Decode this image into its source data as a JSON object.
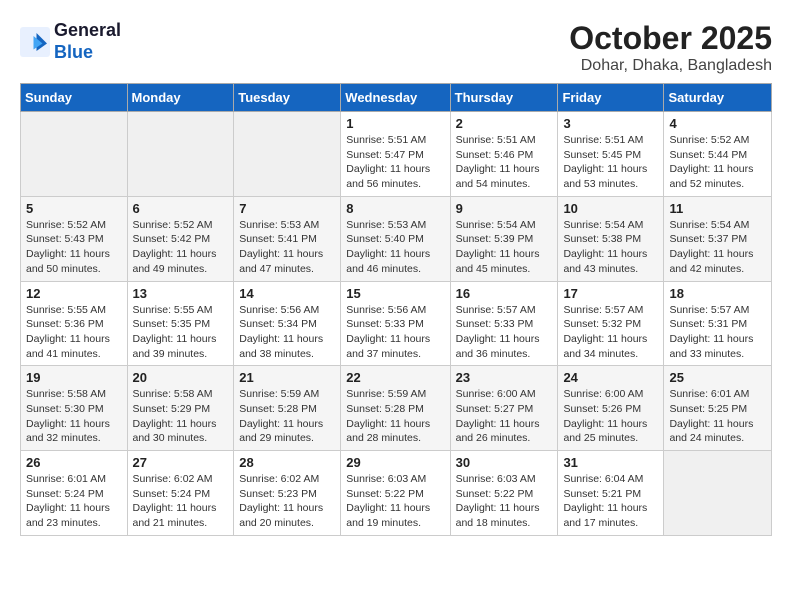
{
  "header": {
    "logo_line1": "General",
    "logo_line2": "Blue",
    "title": "October 2025",
    "subtitle": "Dohar, Dhaka, Bangladesh"
  },
  "weekdays": [
    "Sunday",
    "Monday",
    "Tuesday",
    "Wednesday",
    "Thursday",
    "Friday",
    "Saturday"
  ],
  "weeks": [
    [
      {
        "day": "",
        "info": ""
      },
      {
        "day": "",
        "info": ""
      },
      {
        "day": "",
        "info": ""
      },
      {
        "day": "1",
        "info": "Sunrise: 5:51 AM\nSunset: 5:47 PM\nDaylight: 11 hours and 56 minutes."
      },
      {
        "day": "2",
        "info": "Sunrise: 5:51 AM\nSunset: 5:46 PM\nDaylight: 11 hours and 54 minutes."
      },
      {
        "day": "3",
        "info": "Sunrise: 5:51 AM\nSunset: 5:45 PM\nDaylight: 11 hours and 53 minutes."
      },
      {
        "day": "4",
        "info": "Sunrise: 5:52 AM\nSunset: 5:44 PM\nDaylight: 11 hours and 52 minutes."
      }
    ],
    [
      {
        "day": "5",
        "info": "Sunrise: 5:52 AM\nSunset: 5:43 PM\nDaylight: 11 hours and 50 minutes."
      },
      {
        "day": "6",
        "info": "Sunrise: 5:52 AM\nSunset: 5:42 PM\nDaylight: 11 hours and 49 minutes."
      },
      {
        "day": "7",
        "info": "Sunrise: 5:53 AM\nSunset: 5:41 PM\nDaylight: 11 hours and 47 minutes."
      },
      {
        "day": "8",
        "info": "Sunrise: 5:53 AM\nSunset: 5:40 PM\nDaylight: 11 hours and 46 minutes."
      },
      {
        "day": "9",
        "info": "Sunrise: 5:54 AM\nSunset: 5:39 PM\nDaylight: 11 hours and 45 minutes."
      },
      {
        "day": "10",
        "info": "Sunrise: 5:54 AM\nSunset: 5:38 PM\nDaylight: 11 hours and 43 minutes."
      },
      {
        "day": "11",
        "info": "Sunrise: 5:54 AM\nSunset: 5:37 PM\nDaylight: 11 hours and 42 minutes."
      }
    ],
    [
      {
        "day": "12",
        "info": "Sunrise: 5:55 AM\nSunset: 5:36 PM\nDaylight: 11 hours and 41 minutes."
      },
      {
        "day": "13",
        "info": "Sunrise: 5:55 AM\nSunset: 5:35 PM\nDaylight: 11 hours and 39 minutes."
      },
      {
        "day": "14",
        "info": "Sunrise: 5:56 AM\nSunset: 5:34 PM\nDaylight: 11 hours and 38 minutes."
      },
      {
        "day": "15",
        "info": "Sunrise: 5:56 AM\nSunset: 5:33 PM\nDaylight: 11 hours and 37 minutes."
      },
      {
        "day": "16",
        "info": "Sunrise: 5:57 AM\nSunset: 5:33 PM\nDaylight: 11 hours and 36 minutes."
      },
      {
        "day": "17",
        "info": "Sunrise: 5:57 AM\nSunset: 5:32 PM\nDaylight: 11 hours and 34 minutes."
      },
      {
        "day": "18",
        "info": "Sunrise: 5:57 AM\nSunset: 5:31 PM\nDaylight: 11 hours and 33 minutes."
      }
    ],
    [
      {
        "day": "19",
        "info": "Sunrise: 5:58 AM\nSunset: 5:30 PM\nDaylight: 11 hours and 32 minutes."
      },
      {
        "day": "20",
        "info": "Sunrise: 5:58 AM\nSunset: 5:29 PM\nDaylight: 11 hours and 30 minutes."
      },
      {
        "day": "21",
        "info": "Sunrise: 5:59 AM\nSunset: 5:28 PM\nDaylight: 11 hours and 29 minutes."
      },
      {
        "day": "22",
        "info": "Sunrise: 5:59 AM\nSunset: 5:28 PM\nDaylight: 11 hours and 28 minutes."
      },
      {
        "day": "23",
        "info": "Sunrise: 6:00 AM\nSunset: 5:27 PM\nDaylight: 11 hours and 26 minutes."
      },
      {
        "day": "24",
        "info": "Sunrise: 6:00 AM\nSunset: 5:26 PM\nDaylight: 11 hours and 25 minutes."
      },
      {
        "day": "25",
        "info": "Sunrise: 6:01 AM\nSunset: 5:25 PM\nDaylight: 11 hours and 24 minutes."
      }
    ],
    [
      {
        "day": "26",
        "info": "Sunrise: 6:01 AM\nSunset: 5:24 PM\nDaylight: 11 hours and 23 minutes."
      },
      {
        "day": "27",
        "info": "Sunrise: 6:02 AM\nSunset: 5:24 PM\nDaylight: 11 hours and 21 minutes."
      },
      {
        "day": "28",
        "info": "Sunrise: 6:02 AM\nSunset: 5:23 PM\nDaylight: 11 hours and 20 minutes."
      },
      {
        "day": "29",
        "info": "Sunrise: 6:03 AM\nSunset: 5:22 PM\nDaylight: 11 hours and 19 minutes."
      },
      {
        "day": "30",
        "info": "Sunrise: 6:03 AM\nSunset: 5:22 PM\nDaylight: 11 hours and 18 minutes."
      },
      {
        "day": "31",
        "info": "Sunrise: 6:04 AM\nSunset: 5:21 PM\nDaylight: 11 hours and 17 minutes."
      },
      {
        "day": "",
        "info": ""
      }
    ]
  ]
}
